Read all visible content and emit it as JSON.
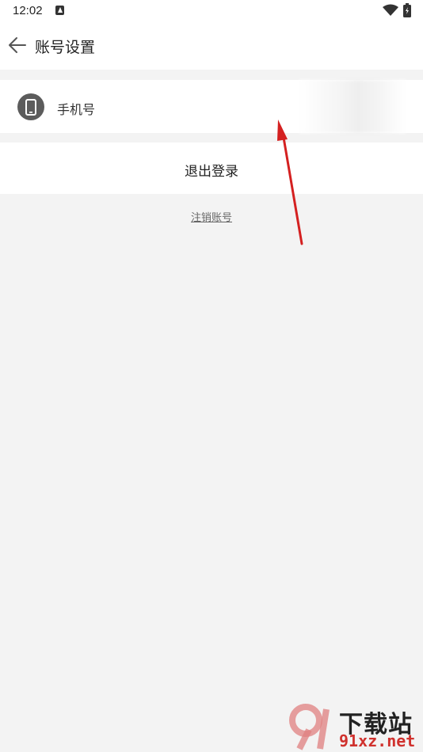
{
  "status_bar": {
    "time": "12:02"
  },
  "header": {
    "title": "账号设置"
  },
  "settings": {
    "phone_label": "手机号",
    "logout_label": "退出登录",
    "cancel_account_label": "注销账号"
  },
  "watermark": {
    "name": "下载站",
    "domain": "91xz.net"
  },
  "colors": {
    "annotation_arrow": "#d42020",
    "background": "#f3f3f3",
    "card": "#ffffff",
    "icon_circle": "#5c5c5c"
  },
  "icons": [
    "android-a-icon",
    "wifi-icon",
    "battery-icon",
    "back-arrow-icon",
    "phone-icon"
  ]
}
